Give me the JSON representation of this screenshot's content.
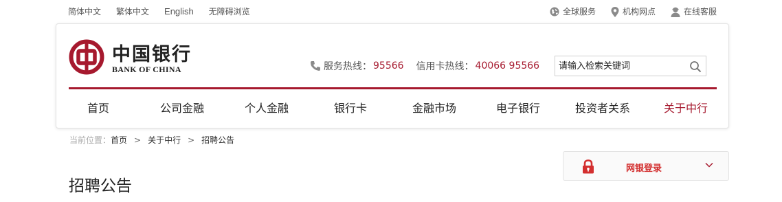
{
  "topbar": {
    "links": [
      "简体中文",
      "繁体中文",
      "English",
      "无障碍浏览"
    ],
    "right": [
      {
        "icon": "globe-icon",
        "label": "全球服务"
      },
      {
        "icon": "location-pin-icon",
        "label": "机构网点"
      },
      {
        "icon": "user-icon",
        "label": "在线客服"
      }
    ]
  },
  "logo": {
    "cn": "中国银行",
    "en": "BANK OF CHINA"
  },
  "hotline": {
    "service_label": "服务热线：",
    "service_number": "95566",
    "card_label": "信用卡热线：",
    "card_number": "40066 95566"
  },
  "search": {
    "placeholder": "请输入检索关键词"
  },
  "nav": {
    "items": [
      "首页",
      "公司金融",
      "个人金融",
      "银行卡",
      "金融市场",
      "电子银行",
      "投资者关系",
      "关于中行"
    ],
    "active_index": 7
  },
  "breadcrumb": {
    "prefix": "当前位置：",
    "items": [
      "首页",
      "关于中行",
      "招聘公告"
    ],
    "separator": ">"
  },
  "login": {
    "label": "网银登录"
  },
  "page": {
    "title": "招聘公告"
  },
  "colors": {
    "brand": "#a6192e",
    "login_red": "#d32f2f"
  }
}
